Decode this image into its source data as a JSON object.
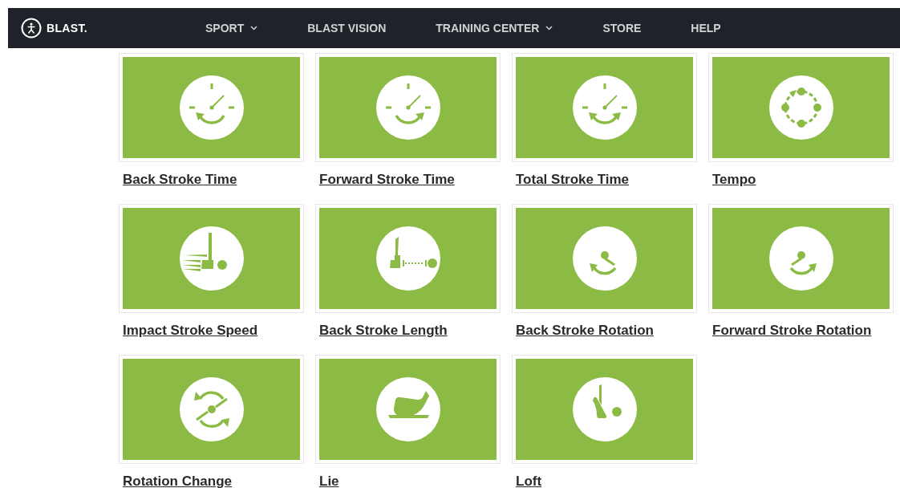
{
  "header": {
    "logo_text": "BLAST.",
    "nav": [
      {
        "label": "SPORT",
        "has_dropdown": true
      },
      {
        "label": "BLAST VISION",
        "has_dropdown": false
      },
      {
        "label": "TRAINING CENTER",
        "has_dropdown": true
      },
      {
        "label": "STORE",
        "has_dropdown": false
      },
      {
        "label": "HELP",
        "has_dropdown": false
      }
    ]
  },
  "metrics": [
    {
      "label": "Back Stroke Time"
    },
    {
      "label": "Forward Stroke Time"
    },
    {
      "label": "Total Stroke Time"
    },
    {
      "label": "Tempo"
    },
    {
      "label": "Impact Stroke Speed"
    },
    {
      "label": "Back Stroke Length"
    },
    {
      "label": "Back Stroke Rotation"
    },
    {
      "label": "Forward Stroke Rotation"
    },
    {
      "label": "Rotation Change"
    },
    {
      "label": "Lie"
    },
    {
      "label": "Loft"
    }
  ]
}
